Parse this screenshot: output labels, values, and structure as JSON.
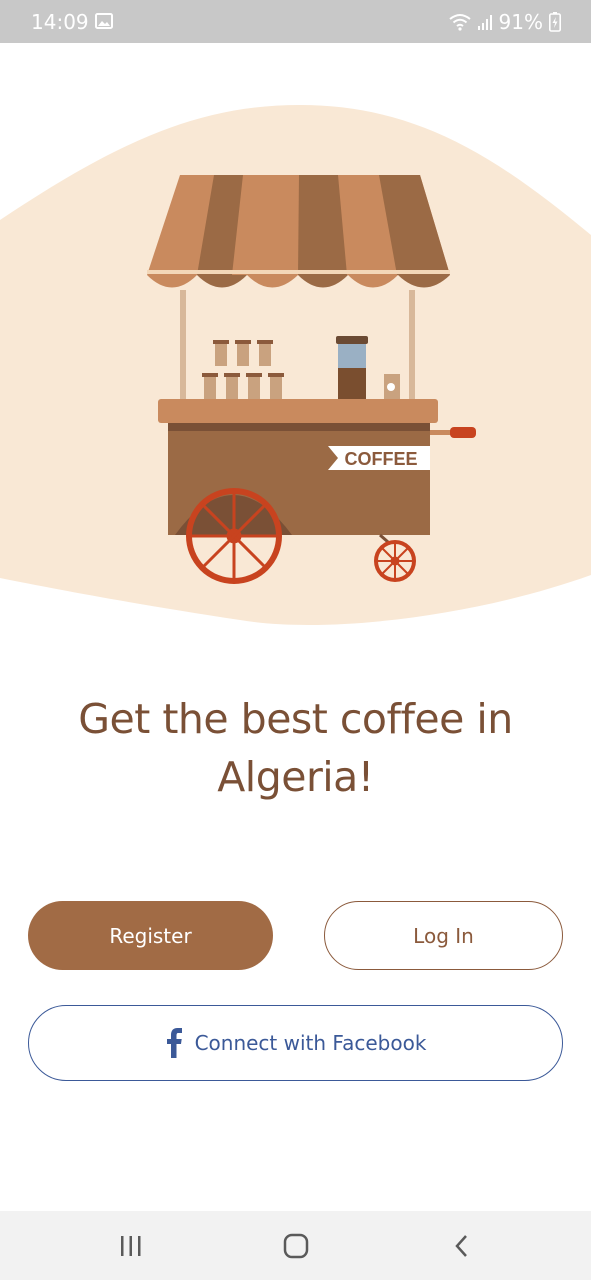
{
  "status_bar": {
    "time": "14:09",
    "battery": "91%",
    "icons": [
      "gallery-icon",
      "wifi-icon",
      "signal-icon",
      "battery-charging-icon"
    ]
  },
  "hero": {
    "sign_text": "COFFEE",
    "colors": {
      "background_blob": "#f9e8d5",
      "awning_light": "#c98a5e",
      "awning_dark": "#9b6a45",
      "cart_body": "#9b6a45",
      "wheel": "#c8431f"
    }
  },
  "headline": "Get the best coffee in Algeria!",
  "buttons": {
    "register": "Register",
    "login": "Log In",
    "facebook": "Connect with Facebook"
  },
  "nav": {
    "icons": [
      "recents-icon",
      "home-icon",
      "back-icon"
    ]
  },
  "colors": {
    "brand_brown": "#a16b45",
    "text_brown": "#7a5036",
    "facebook_blue": "#3b5998"
  }
}
